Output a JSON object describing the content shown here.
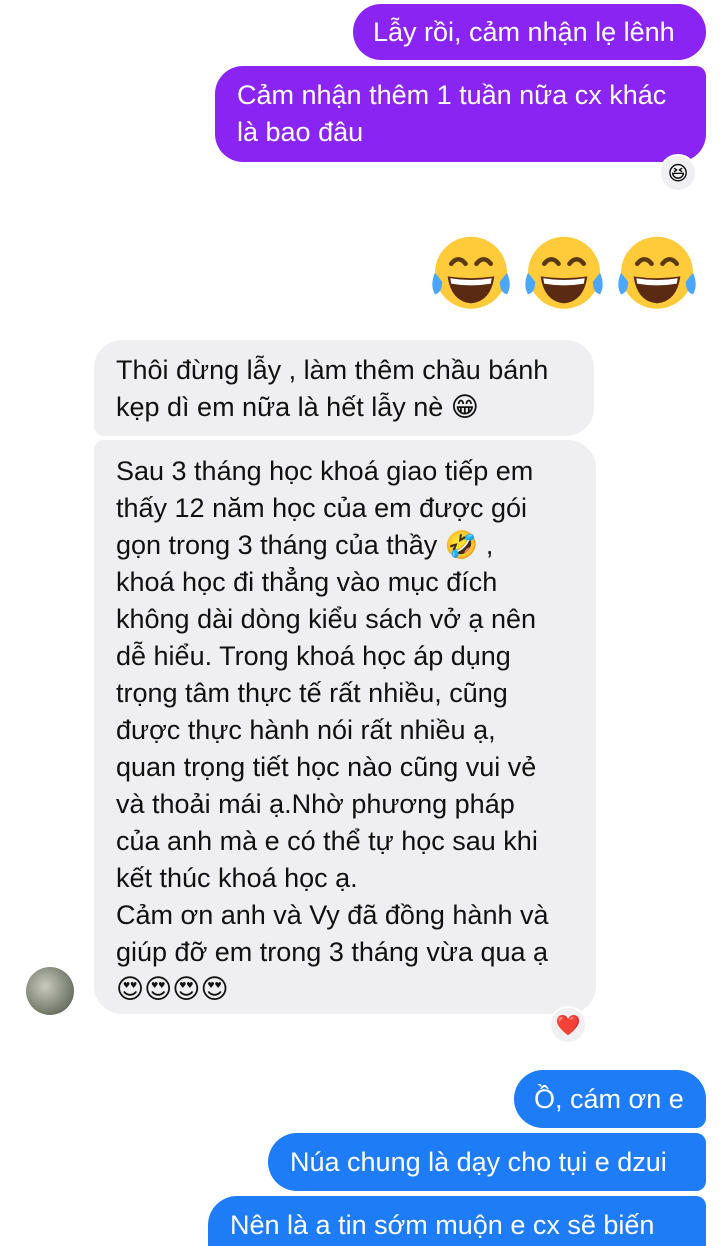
{
  "messages": [
    {
      "id": "m1",
      "direction": "outgoing",
      "text": "Lẫy rồi, cảm nhận lẹ lênh"
    },
    {
      "id": "m2",
      "direction": "outgoing",
      "text": "Cảm nhận thêm 1 tuần nữa cx khác\nlà bao đâu",
      "reaction": "😆"
    },
    {
      "id": "m3",
      "direction": "outgoing",
      "emoji_only": [
        "😂",
        "😂",
        "😂"
      ]
    },
    {
      "id": "m4",
      "direction": "incoming",
      "text": "Thôi đừng lẫy , làm thêm chầu bánh\nkẹp dì em nữa là hết lẫy nè 😁"
    },
    {
      "id": "m5",
      "direction": "incoming",
      "text": "Sau 3 tháng học khoá giao tiếp em\nthấy 12 năm học của em được gói\ngọn trong 3 tháng của thầy 🤣 ,\nkhoá học đi thẳng vào mục đích\nkhông dài dòng kiểu sách vở ạ nên\ndễ hiểu. Trong khoá học áp dụng\ntrọng tâm thực tế rất nhiều, cũng\nđược thực hành nói rất nhiều ạ,\nquan trọng tiết học nào cũng vui vẻ\nvà thoải mái ạ.Nhờ phương pháp\ncủa anh mà e có thể tự học sau khi\nkết thúc khoá học ạ.\nCảm ơn anh và Vy đã đồng hành và\ngiúp đỡ em trong 3 tháng vừa qua ạ\n😍😍😍😍",
      "reaction": "❤️"
    },
    {
      "id": "m6",
      "direction": "outgoing",
      "text": "Ồ, cám ơn e"
    },
    {
      "id": "m7",
      "direction": "outgoing",
      "text": "Núa chung là dạy cho tụi e dzui"
    },
    {
      "id": "m8",
      "direction": "outgoing",
      "text": "Nên là a tin sớm muộn e cx sẽ biến"
    }
  ],
  "colors": {
    "outgoing_purple": "#8a24f2",
    "outgoing_blue": "#1f7cf7",
    "incoming_bg": "#efeff1",
    "background": "#ffffff"
  }
}
